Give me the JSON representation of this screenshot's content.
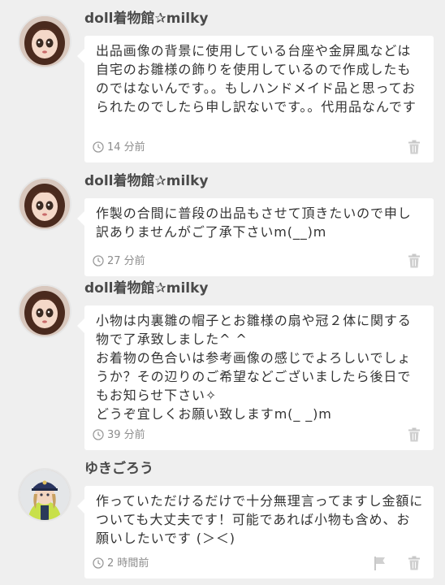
{
  "comments": [
    {
      "author": "doll着物館✰milky",
      "avatar": "doll-avatar",
      "text": "出品画像の背景に使用している台座や金屏風などは自宅のお雛様の飾りを使用しているので作成したものではないんです。。もしハンドメイド品と思っておられたのでしたら申し訳ないです。。代用品なんです",
      "time": "14 分前",
      "actions": [
        "trash-icon"
      ]
    },
    {
      "author": "doll着物館✰milky",
      "avatar": "doll-avatar",
      "text": "作製の合間に普段の出品もさせて頂きたいので申し訳ありませんがご了承下さいm(__)m",
      "time": "27 分前",
      "actions": [
        "trash-icon"
      ]
    },
    {
      "author": "doll着物館✰milky",
      "avatar": "doll-avatar",
      "text": "小物は内裏雛の帽子とお雛様の扇や冠２体に関する物で了承致しました^ ^\nお着物の色合いは参考画像の感じでよろしいでしょうか？その辺りのご希望などございましたら後日でもお知らせ下さい✧\nどうぞ宜しくお願い致しますm(_ _)m",
      "time": "39 分前",
      "actions": [
        "trash-icon"
      ]
    },
    {
      "author": "ゆきごろう",
      "avatar": "user-avatar",
      "text": "作っていただけるだけで十分無理言ってますし金額についても大丈夫です！可能であれば小物も含め、お願いしたいです (＞＜)",
      "time": "2 時間前",
      "actions": [
        "flag-icon",
        "trash-icon"
      ]
    }
  ]
}
